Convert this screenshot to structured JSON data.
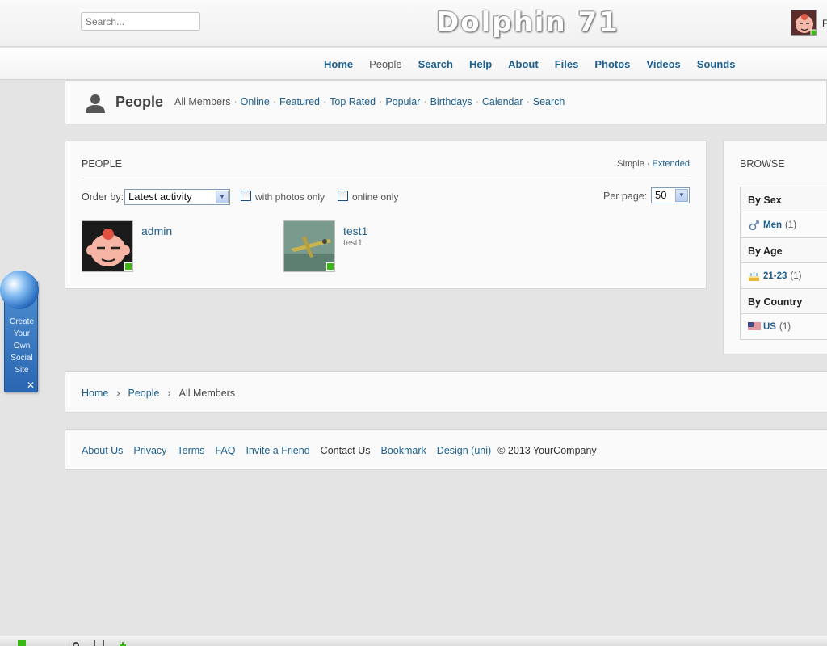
{
  "search": {
    "placeholder": "Search..."
  },
  "header": {
    "site_title": "Dolphin 71",
    "user_name_stub": "F"
  },
  "main_menu": {
    "items": [
      {
        "label": "Home"
      },
      {
        "label": "People",
        "active": true
      },
      {
        "label": "Search"
      },
      {
        "label": "Help"
      },
      {
        "label": "About"
      },
      {
        "label": "Files"
      },
      {
        "label": "Photos"
      },
      {
        "label": "Videos"
      },
      {
        "label": "Sounds"
      }
    ]
  },
  "page_header": {
    "title": "People",
    "submenu": [
      "All Members",
      "Online",
      "Featured",
      "Top Rated",
      "Popular",
      "Birthdays",
      "Calendar",
      "Search"
    ],
    "separator": "·"
  },
  "people_box": {
    "title": "PEOPLE",
    "view_simple": "Simple",
    "view_sep": " · ",
    "view_extended": "Extended",
    "order_label": "Order by:",
    "order_value": "Latest activity",
    "filter_photos": "with photos only",
    "filter_online": "online only",
    "per_page_label": "Per page:",
    "per_page_value": "50",
    "members": [
      {
        "name": "admin",
        "subtitle": ""
      },
      {
        "name": "test1",
        "subtitle": "test1"
      }
    ]
  },
  "browse": {
    "title": "BROWSE",
    "sex_header": "By Sex",
    "sex_item": {
      "label": "Men",
      "count": "(1)"
    },
    "age_header": "By Age",
    "age_item": {
      "label": "21-23",
      "count": "(1)"
    },
    "country_header": "By Country",
    "country_item": {
      "label": "US",
      "count": "(1)"
    }
  },
  "breadcrumb": {
    "home": "Home",
    "people": "People",
    "current": "All Members",
    "separator": "›"
  },
  "footer": {
    "links": [
      "About Us",
      "Privacy",
      "Terms",
      "FAQ",
      "Invite a Friend",
      "Contact Us",
      "Bookmark",
      "Design (uni)"
    ],
    "copyright": "© 2013 YourCompany"
  },
  "promo_widget": {
    "text": "Create Your Own Social Site",
    "close": "✕"
  },
  "colors": {
    "link": "#1e5f8c",
    "online": "#3cb815",
    "widget": "#2a66b2"
  }
}
